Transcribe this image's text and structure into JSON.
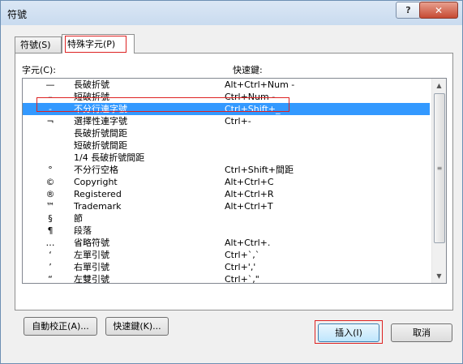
{
  "window": {
    "title": "符號",
    "help_label": "?",
    "close_label": "✕"
  },
  "tabs": [
    {
      "label": "符號(S)"
    },
    {
      "label": "特殊字元(P)"
    }
  ],
  "columns": {
    "character": "字元(C):",
    "shortcut": "快速鍵:"
  },
  "selected_row_index": 2,
  "rows": [
    {
      "symbol": "—",
      "name": "長破折號",
      "shortcut": "Alt+Ctrl+Num -"
    },
    {
      "symbol": "–",
      "name": "短破折號",
      "shortcut": "Ctrl+Num -"
    },
    {
      "symbol": "-",
      "name": "不分行連字號",
      "shortcut": "Ctrl+Shift+_"
    },
    {
      "symbol": "¬",
      "name": "選擇性連字號",
      "shortcut": "Ctrl+-"
    },
    {
      "symbol": "",
      "name": "長破折號間距",
      "shortcut": ""
    },
    {
      "symbol": "",
      "name": "短破折號間距",
      "shortcut": ""
    },
    {
      "symbol": "",
      "name": "1/4 長破折號間距",
      "shortcut": ""
    },
    {
      "symbol": "°",
      "name": "不分行空格",
      "shortcut": "Ctrl+Shift+間距"
    },
    {
      "symbol": "©",
      "name": "Copyright",
      "shortcut": "Alt+Ctrl+C"
    },
    {
      "symbol": "®",
      "name": "Registered",
      "shortcut": "Alt+Ctrl+R"
    },
    {
      "symbol": "™",
      "name": "Trademark",
      "shortcut": "Alt+Ctrl+T"
    },
    {
      "symbol": "§",
      "name": "節",
      "shortcut": ""
    },
    {
      "symbol": "¶",
      "name": "段落",
      "shortcut": ""
    },
    {
      "symbol": "…",
      "name": "省略符號",
      "shortcut": "Alt+Ctrl+."
    },
    {
      "symbol": "‘",
      "name": "左單引號",
      "shortcut": "Ctrl+`,`"
    },
    {
      "symbol": "’",
      "name": "右單引號",
      "shortcut": "Ctrl+','"
    },
    {
      "symbol": "“",
      "name": "左雙引號",
      "shortcut": "Ctrl+`,\""
    }
  ],
  "buttons": {
    "autocorrect": "自動校正(A)...",
    "shortcut_key": "快速鍵(K)...",
    "insert": "插入(I)",
    "cancel": "取消"
  }
}
